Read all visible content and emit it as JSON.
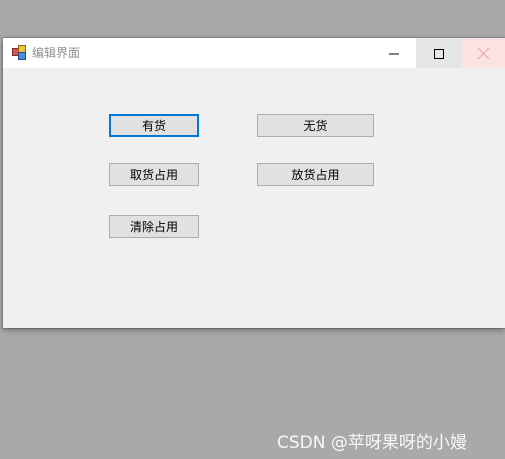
{
  "window": {
    "title": "编辑界面",
    "controls": {
      "minimize_icon": "minimize-icon",
      "maximize_icon": "maximize-icon",
      "close_icon": "close-icon"
    }
  },
  "buttons": {
    "in_stock": "有货",
    "out_of_stock": "无货",
    "pickup_occupy": "取货占用",
    "putaway_occupy": "放货占用",
    "clear_occupy": "清除占用"
  },
  "watermark": "CSDN @苹呀果呀的小嫚",
  "colors": {
    "focus_border": "#0078d7",
    "close_hover": "#fbe3e4",
    "button_bg": "#e1e1e1"
  }
}
